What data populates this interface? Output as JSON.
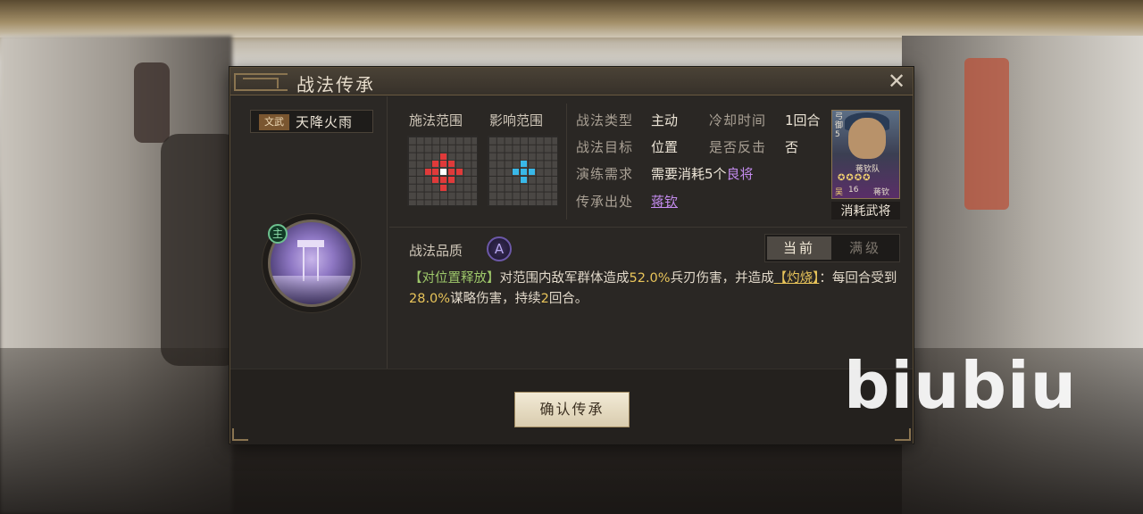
{
  "dialog": {
    "title": "战法传承",
    "close_icon": "close-icon"
  },
  "skill": {
    "tag": "文武",
    "name": "天降火雨",
    "main_badge": "主",
    "quality_label": "战法品质",
    "quality_value": "A"
  },
  "ranges": {
    "cast_label": "施法范围",
    "effect_label": "影响范围",
    "cast_color": "#e03a3a",
    "effect_color": "#39b8e8",
    "center_color": "#ffffff"
  },
  "info": {
    "type_label": "战法类型",
    "type_value": "主动",
    "cooldown_label": "冷却时间",
    "cooldown_value": "1回合",
    "target_label": "战法目标",
    "target_value": "位置",
    "counter_label": "是否反击",
    "counter_value": "否",
    "practice_label": "演练需求",
    "practice_value_prefix": "需要消耗5个",
    "practice_value_highlight": "良将",
    "source_label": "传承出处",
    "source_value": "蒋钦"
  },
  "general_card": {
    "corner_text": "弓御5",
    "name_on_card": "蒋钦队",
    "level": "16",
    "faction": "吴",
    "short_name": "蒋钦",
    "caption": "消耗武将"
  },
  "tabs": {
    "current": "当前",
    "max": "满级"
  },
  "description": {
    "tag": "【对位置释放】",
    "text1": "对范围内敌军群体造成",
    "val1": "52.0%",
    "text2": "兵刃伤害，并造成",
    "status": "【灼烧】",
    "text3": "：每回合受到",
    "val2": "28.0%",
    "text4": "谋略伤害，持续",
    "val3": "2",
    "text5": "回合。"
  },
  "buttons": {
    "confirm": "确认传承"
  },
  "watermark": "biubiu"
}
